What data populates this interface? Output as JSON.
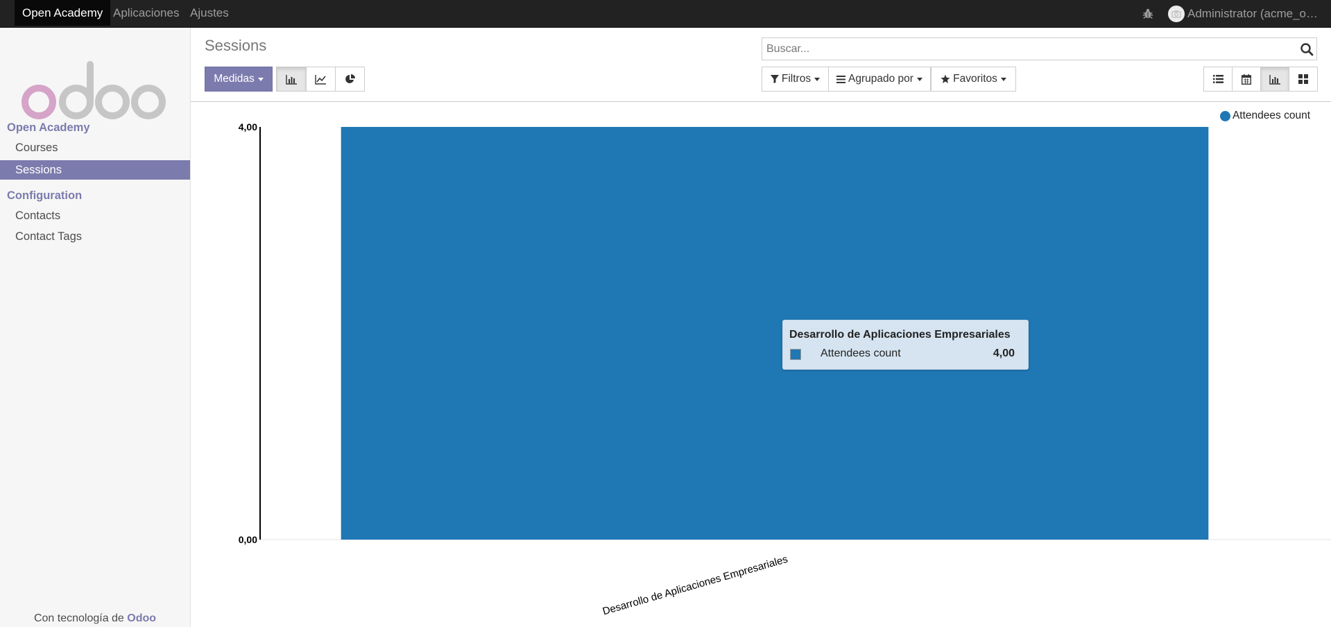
{
  "topbar": {
    "menu": [
      "Open Academy",
      "Aplicaciones",
      "Ajustes"
    ],
    "user": "Administrator (acme_o…"
  },
  "sidebar": {
    "sections": [
      {
        "title": "Open Academy",
        "items": [
          "Courses",
          "Sessions"
        ]
      },
      {
        "title": "Configuration",
        "items": [
          "Contacts",
          "Contact Tags"
        ]
      }
    ],
    "active_item": "Sessions",
    "powered_by_prefix": "Con tecnología de",
    "powered_by_brand": "Odoo"
  },
  "control_panel": {
    "breadcrumb": "Sessions",
    "measures_label": "Medidas",
    "search_placeholder": "Buscar...",
    "filters_label": "Filtros",
    "groupby_label": "Agrupado por",
    "favorites_label": "Favoritos",
    "chart_modes": [
      "bar-chart-icon",
      "line-chart-icon",
      "pie-chart-icon"
    ],
    "views": [
      "list-view-icon",
      "calendar-view-icon",
      "graph-view-icon",
      "kanban-view-icon"
    ],
    "active_view": "graph-view-icon"
  },
  "colors": {
    "brand": "#7c7bad",
    "bar": "#1f77b4",
    "topbar": "#222222"
  },
  "chart_data": {
    "type": "bar",
    "categories": [
      "Desarrollo de Aplicaciones Empresariales"
    ],
    "series": [
      {
        "name": "Attendees count",
        "values": [
          4
        ]
      }
    ],
    "ylim": [
      0,
      4
    ],
    "yticks": [
      "0,00",
      "4,00"
    ],
    "legend_position": "top-right",
    "tooltip": {
      "title": "Desarrollo de Aplicaciones Empresariales",
      "label": "Attendees count",
      "value": "4,00"
    }
  }
}
